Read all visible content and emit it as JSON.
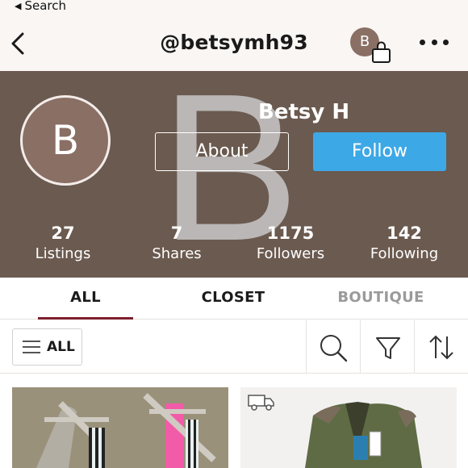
{
  "status": {
    "back_label": "Search"
  },
  "nav": {
    "title": "@betsymh93",
    "avatar_letter": "B"
  },
  "profile": {
    "watermark_letter": "B",
    "avatar_letter": "B",
    "name": "Betsy H",
    "about_label": "About",
    "follow_label": "Follow",
    "stats": [
      {
        "value": "27",
        "label": "Listings"
      },
      {
        "value": "7",
        "label": "Shares"
      },
      {
        "value": "1175",
        "label": "Followers"
      },
      {
        "value": "142",
        "label": "Following"
      }
    ]
  },
  "tabs": [
    {
      "label": "ALL",
      "active": true
    },
    {
      "label": "CLOSET",
      "active": false
    },
    {
      "label": "BOUTIQUE",
      "active": false
    }
  ],
  "filter": {
    "all_label": "ALL"
  },
  "colors": {
    "brand_maroon": "#7d1f2c",
    "follow_blue": "#3da8e6",
    "header_brown": "#6b5a4f",
    "avatar_brown": "#8a6f64"
  },
  "icons": [
    "chevron-left-icon",
    "shopping-bag-icon",
    "more-dots-icon",
    "menu-icon",
    "search-icon",
    "filter-icon",
    "sort-icon",
    "shipping-truck-icon"
  ]
}
